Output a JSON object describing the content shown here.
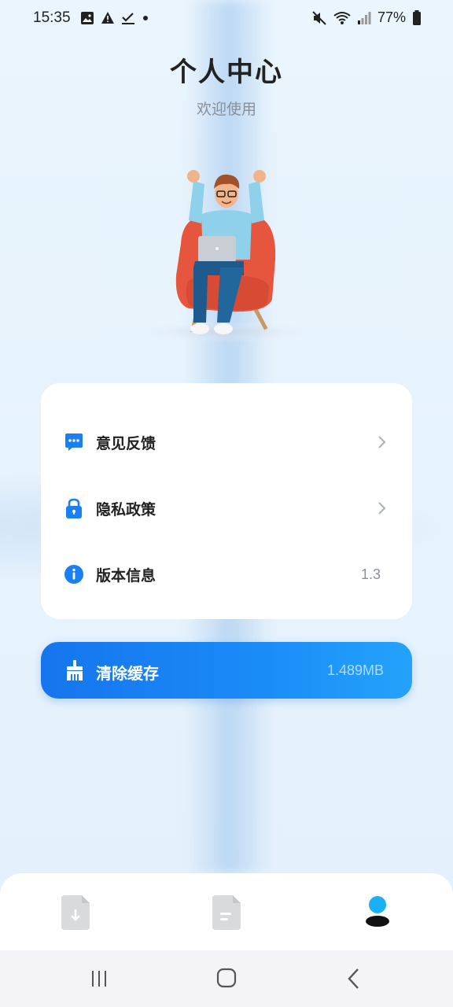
{
  "status_bar": {
    "time": "15:35",
    "battery": "77%"
  },
  "header": {
    "title": "个人中心",
    "subtitle": "欢迎使用"
  },
  "menu": {
    "items": [
      {
        "label": "意见反馈",
        "icon": "chat-bubble-icon",
        "trailing": "chevron-right-icon"
      },
      {
        "label": "隐私政策",
        "icon": "lock-icon",
        "trailing": "chevron-right-icon"
      },
      {
        "label": "版本信息",
        "icon": "info-icon",
        "value": "1.3"
      }
    ]
  },
  "cache": {
    "label": "清除缓存",
    "value": "1.489MB",
    "icon": "broom-icon"
  },
  "tabs": [
    {
      "icon": "file-download-icon",
      "active": false
    },
    {
      "icon": "document-icon",
      "active": false
    },
    {
      "icon": "user-icon",
      "active": true
    }
  ],
  "colors": {
    "accent": "#1a7ff2",
    "text": "#222222",
    "muted": "#8a8f96"
  }
}
